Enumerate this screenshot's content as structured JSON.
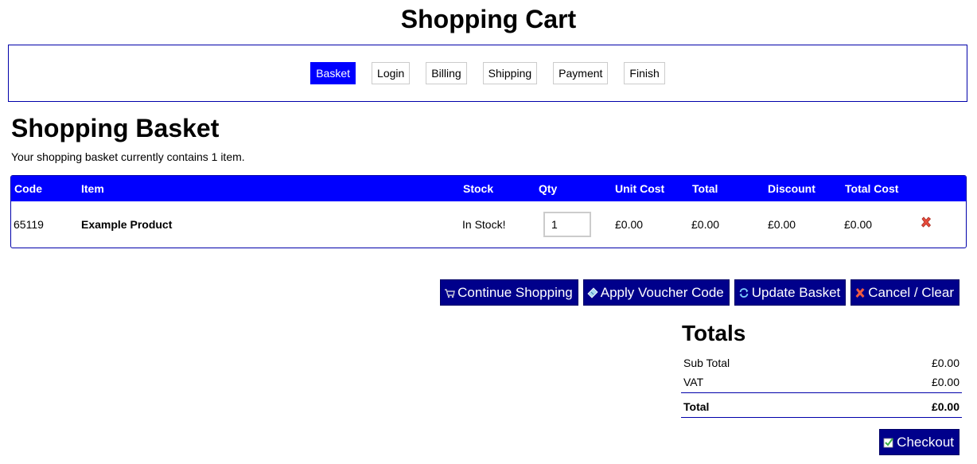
{
  "header": {
    "title": "Shopping Cart"
  },
  "steps": [
    {
      "label": "Basket",
      "active": true
    },
    {
      "label": "Login",
      "active": false
    },
    {
      "label": "Billing",
      "active": false
    },
    {
      "label": "Shipping",
      "active": false
    },
    {
      "label": "Payment",
      "active": false
    },
    {
      "label": "Finish",
      "active": false
    }
  ],
  "basket": {
    "title": "Shopping Basket",
    "summary": "Your shopping basket currently contains 1 item.",
    "columns": {
      "code": "Code",
      "item": "Item",
      "stock": "Stock",
      "qty": "Qty",
      "unit_cost": "Unit Cost",
      "total": "Total",
      "discount": "Discount",
      "total_cost": "Total Cost"
    },
    "rows": [
      {
        "code": "65119",
        "item": "Example Product",
        "stock": "In Stock!",
        "qty": "1",
        "unit_cost": "£0.00",
        "total": "£0.00",
        "discount": "£0.00",
        "total_cost": "£0.00",
        "remove_icon": "red-x-icon"
      }
    ]
  },
  "actions": {
    "continue_label": "Continue Shopping",
    "voucher_label": "Apply Voucher Code",
    "update_label": "Update Basket",
    "cancel_label": "Cancel / Clear"
  },
  "totals": {
    "title": "Totals",
    "subtotal_label": "Sub Total",
    "subtotal_value": "£0.00",
    "vat_label": "VAT",
    "vat_value": "£0.00",
    "total_label": "Total",
    "total_value": "£0.00"
  },
  "checkout": {
    "label": "Checkout"
  },
  "colors": {
    "accent": "#0000ff",
    "button": "#00008b",
    "border": "#0000aa"
  }
}
